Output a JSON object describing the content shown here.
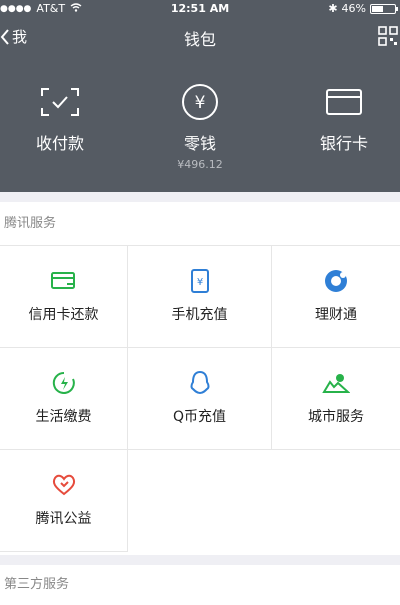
{
  "status": {
    "carrier": "AT&T",
    "time": "12:51 AM",
    "battery": "46%"
  },
  "nav": {
    "back_label": "我",
    "title": "钱包"
  },
  "wallet_actions": [
    {
      "name": "scan-pay",
      "label": "收付款",
      "icon": "scan-check-icon"
    },
    {
      "name": "change",
      "label": "零钱",
      "sub": "¥496.12",
      "icon": "yen-coin-icon"
    },
    {
      "name": "bank-card",
      "label": "银行卡",
      "icon": "card-icon"
    }
  ],
  "sections": {
    "tencent": {
      "title": "腾讯服务",
      "items": [
        {
          "label": "信用卡还款",
          "icon": "credit-card-icon",
          "color": "#27b24a"
        },
        {
          "label": "手机充值",
          "icon": "phone-recharge-icon",
          "color": "#2f7fd6"
        },
        {
          "label": "理财通",
          "icon": "finance-icon",
          "color": "#2f7fd6"
        },
        {
          "label": "生活缴费",
          "icon": "lightning-icon",
          "color": "#27b24a"
        },
        {
          "label": "Q币充值",
          "icon": "qq-penguin-icon",
          "color": "#2f7fd6"
        },
        {
          "label": "城市服务",
          "icon": "city-icon",
          "color": "#27b24a"
        },
        {
          "label": "腾讯公益",
          "icon": "heart-icon",
          "color": "#e64b3c"
        }
      ]
    },
    "thirdparty": {
      "title": "第三方服务"
    }
  }
}
